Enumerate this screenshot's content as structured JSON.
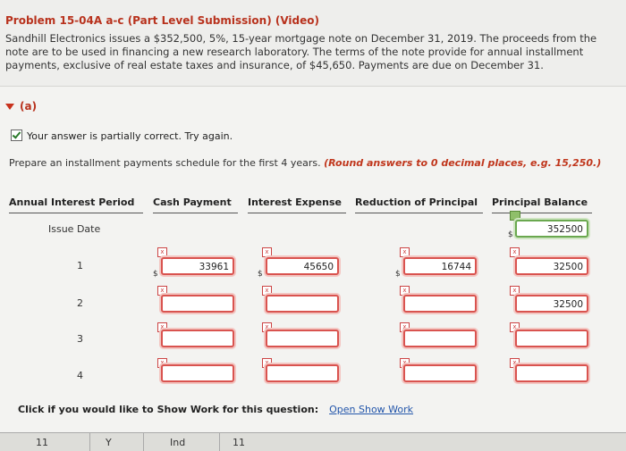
{
  "problem": {
    "title": "Problem 15-04A a-c (Part Level Submission) (Video)",
    "text": "Sandhill Electronics issues a $352,500, 5%, 15-year mortgage note on December 31, 2019. The proceeds from the note are to be used in financing a new research laboratory. The terms of the note provide for annual installment payments, exclusive of real estate taxes and insurance, of $45,650. Payments are due on December 31."
  },
  "section": {
    "label": "(a)"
  },
  "status": {
    "text": "Your answer is partially correct.  Try again."
  },
  "instruction": {
    "text": "Prepare an installment payments schedule for the first 4 years. ",
    "hint": "(Round answers to 0 decimal places, e.g. 15,250.)"
  },
  "table": {
    "headers": [
      "Annual Interest Period",
      "Cash Payment",
      "Interest Expense",
      "Reduction of Principal",
      "Principal Balance"
    ],
    "issue_label": "Issue Date",
    "issue_balance": "352500",
    "rows": [
      {
        "period": "1",
        "cash": "33961",
        "interest": "45650",
        "reduction": "16744",
        "balance": "32500"
      },
      {
        "period": "2",
        "cash": "",
        "interest": "",
        "reduction": "",
        "balance": "32500"
      },
      {
        "period": "3",
        "cash": "",
        "interest": "",
        "reduction": "",
        "balance": ""
      },
      {
        "period": "4",
        "cash": "",
        "interest": "",
        "reduction": "",
        "balance": ""
      }
    ],
    "currency": "$"
  },
  "show_work": {
    "label": "Click if you would like to Show Work for this question:",
    "link": "Open Show Work"
  },
  "bottom_bar": {
    "cells": [
      "11",
      "Y",
      "Ind",
      "11"
    ]
  }
}
